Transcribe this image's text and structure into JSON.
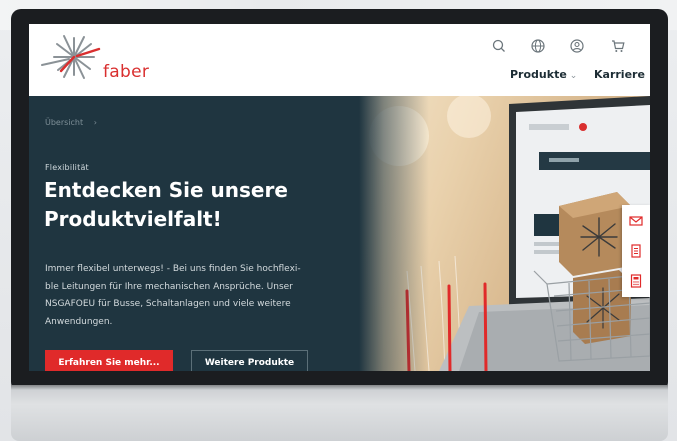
{
  "header": {
    "logo_text": "faber",
    "icons": [
      "search-icon",
      "globe-icon",
      "user-icon",
      "cart-icon"
    ],
    "nav": [
      {
        "label": "Produkte",
        "has_dropdown": true
      },
      {
        "label": "Karriere",
        "has_dropdown": false
      }
    ]
  },
  "hero": {
    "breadcrumb": "Übersicht",
    "breadcrumb_separator": "›",
    "eyebrow": "Flexibilität",
    "headline_line1": "Entdecken Sie unsere",
    "headline_line2": "Produktvielfalt!",
    "body_lines": [
      "Immer flexibel unterwegs! - Bei uns finden Sie hochflexi-",
      "ble Leitungen für Ihre mechanischen Ansprüche. Unser",
      "NSGAFOEU für Busse, Schaltanlagen und viele weitere",
      "Anwendungen."
    ],
    "primary_button": "Erfahren Sie mehr...",
    "secondary_button": "Weitere Produkte"
  },
  "side_tab": {
    "icons": [
      "mail-icon",
      "document-icon",
      "calculator-icon"
    ]
  },
  "colors": {
    "brand_red": "#e02a2a",
    "hero_dark": "#1f3540",
    "header_bg": "#ffffff"
  }
}
